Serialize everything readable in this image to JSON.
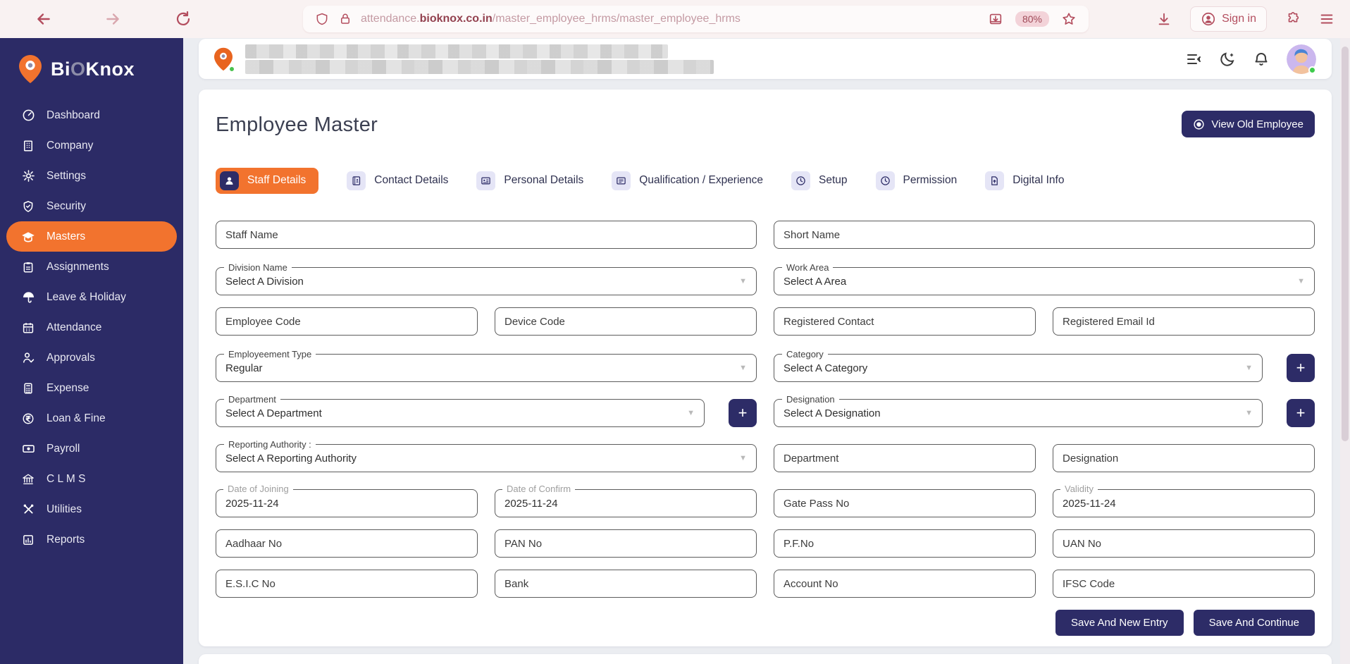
{
  "browser": {
    "url_sub": "attendance.",
    "url_domain": "bioknox.co.in",
    "url_path": "/master_employee_hrms/master_employee_hrms",
    "zoom_badge": "80%",
    "sign_in_label": "Sign in"
  },
  "sidebar": {
    "brand_bi": "Bi",
    "brand_o": "O",
    "brand_knox": "Knox",
    "items": [
      {
        "label": "Dashboard"
      },
      {
        "label": "Company"
      },
      {
        "label": "Settings"
      },
      {
        "label": "Security"
      },
      {
        "label": "Masters",
        "active": true
      },
      {
        "label": "Assignments"
      },
      {
        "label": "Leave & Holiday"
      },
      {
        "label": "Attendance"
      },
      {
        "label": "Approvals"
      },
      {
        "label": "Expense"
      },
      {
        "label": "Loan & Fine"
      },
      {
        "label": "Payroll"
      },
      {
        "label": "C L M S"
      },
      {
        "label": "Utilities"
      },
      {
        "label": "Reports"
      }
    ]
  },
  "page": {
    "title": "Employee Master",
    "view_old_button": "View Old Employee",
    "tabs": [
      {
        "label": "Staff Details",
        "active": true
      },
      {
        "label": "Contact Details"
      },
      {
        "label": "Personal Details"
      },
      {
        "label": "Qualification / Experience"
      },
      {
        "label": "Setup"
      },
      {
        "label": "Permission"
      },
      {
        "label": "Digital Info"
      }
    ],
    "form": {
      "staff_name_ph": "Staff Name",
      "short_name_ph": "Short Name",
      "division_label": "Division Name",
      "division_value": "Select A Division",
      "work_area_label": "Work Area",
      "work_area_value": "Select A Area",
      "employee_code_ph": "Employee Code",
      "device_code_ph": "Device Code",
      "registered_contact_ph": "Registered Contact",
      "registered_email_ph": "Registered Email Id",
      "employment_type_label": "Employeement Type",
      "employment_type_value": "Regular",
      "category_label": "Category",
      "category_value": "Select A Category",
      "department_label": "Department",
      "department_value": "Select A Department",
      "designation_label": "Designation",
      "designation_value": "Select A Designation",
      "reporting_authority_label": "Reporting Authority :",
      "reporting_authority_value": "Select A Reporting Authority",
      "department_input_ph": "Department",
      "designation_input_ph": "Designation",
      "date_of_joining_label": "Date of Joining",
      "date_of_joining_value": "2025-11-24",
      "date_of_confirm_label": "Date of Confirm",
      "date_of_confirm_value": "2025-11-24",
      "gate_pass_ph": "Gate Pass No",
      "validity_label": "Validity",
      "validity_value": "2025-11-24",
      "aadhaar_ph": "Aadhaar No",
      "pan_ph": "PAN No",
      "pf_ph": "P.F.No",
      "uan_ph": "UAN No",
      "esic_ph": "E.S.I.C No",
      "bank_ph": "Bank",
      "account_ph": "Account No",
      "ifsc_ph": "IFSC Code"
    },
    "buttons": {
      "save_new": "Save And New Entry",
      "save_continue": "Save And Continue"
    }
  },
  "colors": {
    "sidebar_navy": "#2c2b66",
    "accent_orange": "#f2732e",
    "button_navy": "#2d2c67",
    "chrome_accent": "#b34d5e",
    "online_green": "#3ecb4d"
  }
}
